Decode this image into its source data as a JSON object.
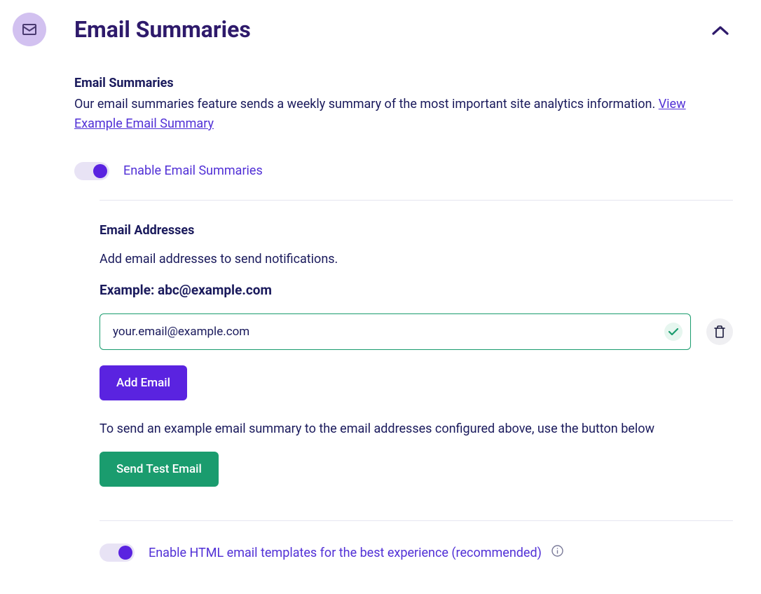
{
  "header": {
    "title": "Email Summaries"
  },
  "summary": {
    "heading": "Email Summaries",
    "description": "Our email summaries feature sends a weekly summary of the most important site analytics information. ",
    "link_text": "View Example Email Summary"
  },
  "toggle_enable": {
    "label": "Enable Email Summaries"
  },
  "addresses": {
    "heading": "Email Addresses",
    "description": "Add email addresses to send notifications.",
    "example_label": "Example: abc@example.com",
    "input_value": "your.email@example.com",
    "add_button": "Add Email",
    "test_description": "To send an example email summary to the email addresses configured above, use the button below",
    "test_button": "Send Test Email"
  },
  "toggle_html": {
    "label": "Enable HTML email templates for the best experience (recommended)"
  }
}
